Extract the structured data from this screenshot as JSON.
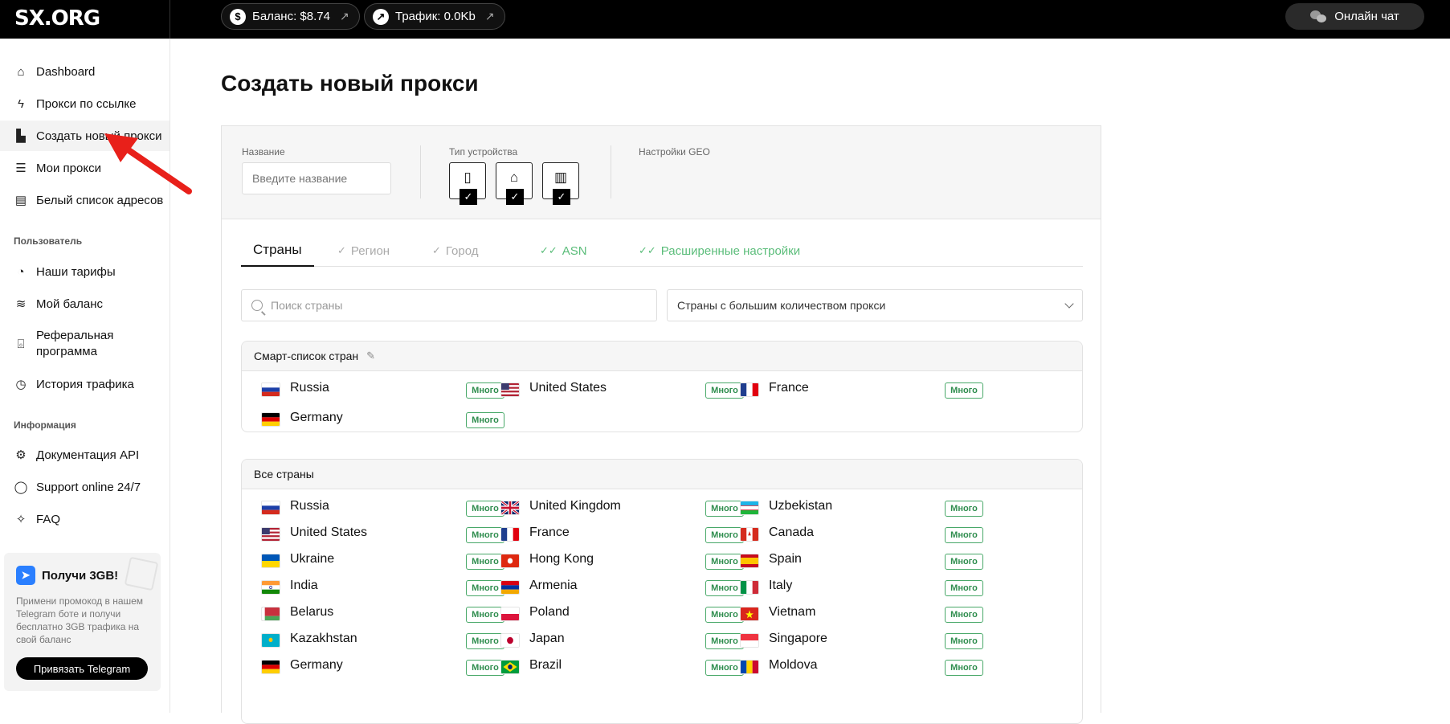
{
  "topbar": {
    "logo": "SX.ORG",
    "balance": "Баланс: $8.74",
    "traffic": "Трафик: 0.0Kb",
    "chat": "Онлайн чат"
  },
  "sidebar": {
    "items": [
      {
        "label": "Dashboard",
        "icon": "home-icon"
      },
      {
        "label": "Прокси по ссылке",
        "icon": "lightning-icon"
      },
      {
        "label": "Создать новый прокси",
        "icon": "file-plus-icon"
      },
      {
        "label": "Мои прокси",
        "icon": "server-icon"
      },
      {
        "label": "Белый список адресов",
        "icon": "list-icon"
      }
    ],
    "section_user": "Пользователь",
    "user_items": [
      {
        "label": "Наши тарифы",
        "icon": "pricing-icon"
      },
      {
        "label": "Мой баланс",
        "icon": "database-icon"
      },
      {
        "label": "Реферальная программа",
        "icon": "gift-icon"
      },
      {
        "label": "История трафика",
        "icon": "clock-icon"
      }
    ],
    "section_info": "Информация",
    "info_items": [
      {
        "label": "Документация API",
        "icon": "gear-icon"
      },
      {
        "label": "Support online 24/7",
        "icon": "chat-icon"
      },
      {
        "label": "FAQ",
        "icon": "sparkle-icon"
      }
    ],
    "promo": {
      "title": "Получи 3GB!",
      "text": "Примени промокод в нашем Telegram боте и получи бесплатно 3GB трафика на свой баланс",
      "button": "Привязать Telegram"
    }
  },
  "main": {
    "title": "Создать новый прокси",
    "name_label": "Название",
    "name_placeholder": "Введите название",
    "device_label": "Тип устройства",
    "geo_label": "Настройки GEO",
    "tabs": [
      "Страны",
      "Регион",
      "Город",
      "ASN",
      "Расширенные настройки"
    ],
    "search_placeholder": "Поиск страны",
    "sort_select": "Страны с большим количеством прокси",
    "smart_title": "Смарт-список стран",
    "all_title": "Все страны",
    "badge": "Много",
    "smart": [
      "Russia",
      "United States",
      "France",
      "Germany"
    ],
    "all": [
      "Russia",
      "United Kingdom",
      "Uzbekistan",
      "United States",
      "France",
      "Canada",
      "Ukraine",
      "Hong Kong",
      "Spain",
      "India",
      "Armenia",
      "Italy",
      "Belarus",
      "Poland",
      "Vietnam",
      "Kazakhstan",
      "Japan",
      "Singapore",
      "Germany",
      "Brazil",
      "Moldova"
    ]
  },
  "colors": {
    "accent_green": "#48a868",
    "telegram_blue": "#2a7fff",
    "arrow_red": "#e8201a"
  }
}
